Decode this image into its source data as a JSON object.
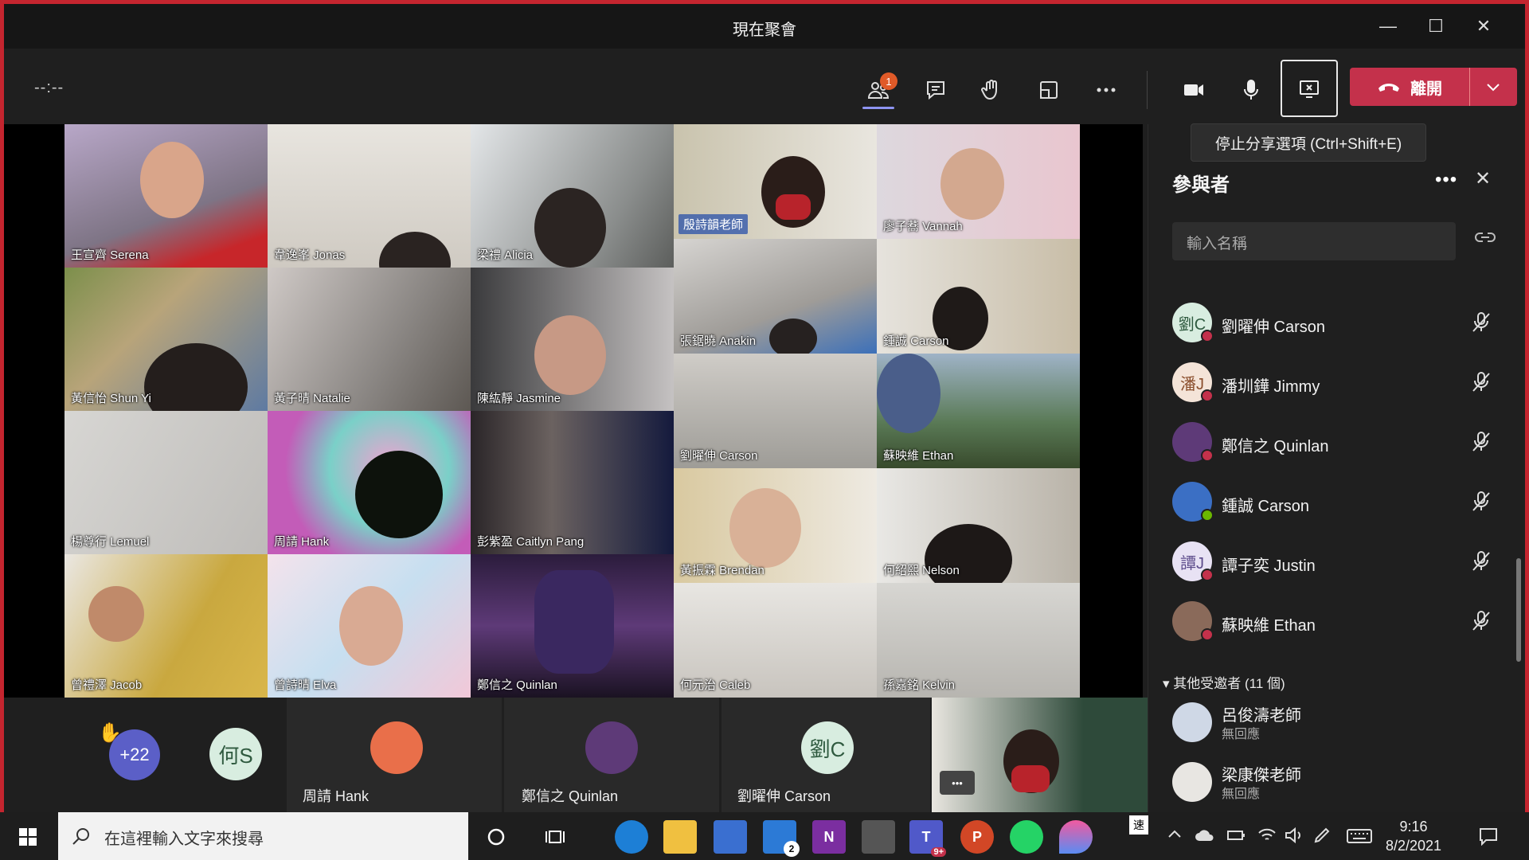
{
  "window": {
    "title": "現在聚會",
    "minimize": "—",
    "maximize": "☐",
    "close": "✕"
  },
  "toolbar": {
    "timer": "--:--",
    "participants_badge": "1",
    "leave_label": "離開",
    "tooltip": "停止分享選項 (Ctrl+Shift+E)"
  },
  "grid_tiles": [
    {
      "name": "王宣齊 Serena"
    },
    {
      "name": "韋逸峯 Jonas"
    },
    {
      "name": "梁禮 Alicia"
    },
    {
      "name": "殷詩韻老師"
    },
    {
      "name": "廖子蕎 Vannah"
    },
    {
      "name": "黃信怡 Shun Yi"
    },
    {
      "name": "黃子晴 Natalie"
    },
    {
      "name": "陳紘靜 Jasmine"
    },
    {
      "name": "張鋸曉 Anakin"
    },
    {
      "name": "鍾誠 Carson"
    },
    {
      "name": "楊尊行 Lemuel"
    },
    {
      "name": "周請 Hank"
    },
    {
      "name": "彭紫盈 Caitlyn Pang"
    },
    {
      "name": "劉曜伸 Carson"
    },
    {
      "name": "蘇映維 Ethan"
    },
    {
      "name": "黃振霖 Brendan"
    },
    {
      "name": "何紹熙 Nelson"
    },
    {
      "name": "曾禮澤 Jacob"
    },
    {
      "name": "曾詩晴 Elva"
    },
    {
      "name": "鄭信之 Quinlan"
    },
    {
      "name": "何元治 Caleb"
    },
    {
      "name": "孫嘉銘 Kelvin"
    }
  ],
  "strip": {
    "more_count": "+22",
    "initials_he": "何S",
    "hand_icon": "✋",
    "hank": "周請 Hank",
    "quinlan": "鄭信之 Quinlan",
    "carson": "劉曜伸 Carson",
    "carson_initials": "劉C",
    "dots": "•••"
  },
  "panel": {
    "title": "參與者",
    "more": "•••",
    "close": "✕",
    "search_placeholder": "輸入名稱",
    "participants": [
      {
        "name": "劉曜伸 Carson",
        "initials": "劉C"
      },
      {
        "name": "潘圳鏵 Jimmy",
        "initials": "潘J"
      },
      {
        "name": "鄭信之 Quinlan",
        "initials": ""
      },
      {
        "name": "鍾誠 Carson",
        "initials": ""
      },
      {
        "name": "譚子奕 Justin",
        "initials": "譚J"
      },
      {
        "name": "蘇映維 Ethan",
        "initials": ""
      }
    ],
    "invited_section": "其他受邀者 (11 個)",
    "invited": [
      {
        "name": "呂俊濤老師",
        "status": "無回應"
      },
      {
        "name": "梁康傑老師",
        "status": "無回應"
      }
    ]
  },
  "taskbar": {
    "search_placeholder": "在這裡輸入文字來搜尋",
    "mail_badge": "2",
    "teams_badge": "9+",
    "ime": "速",
    "time": "9:16",
    "date": "8/2/2021"
  },
  "colors": {
    "accent": "#c4314b",
    "brand": "#8e94f2",
    "frame": "#c4252f"
  }
}
